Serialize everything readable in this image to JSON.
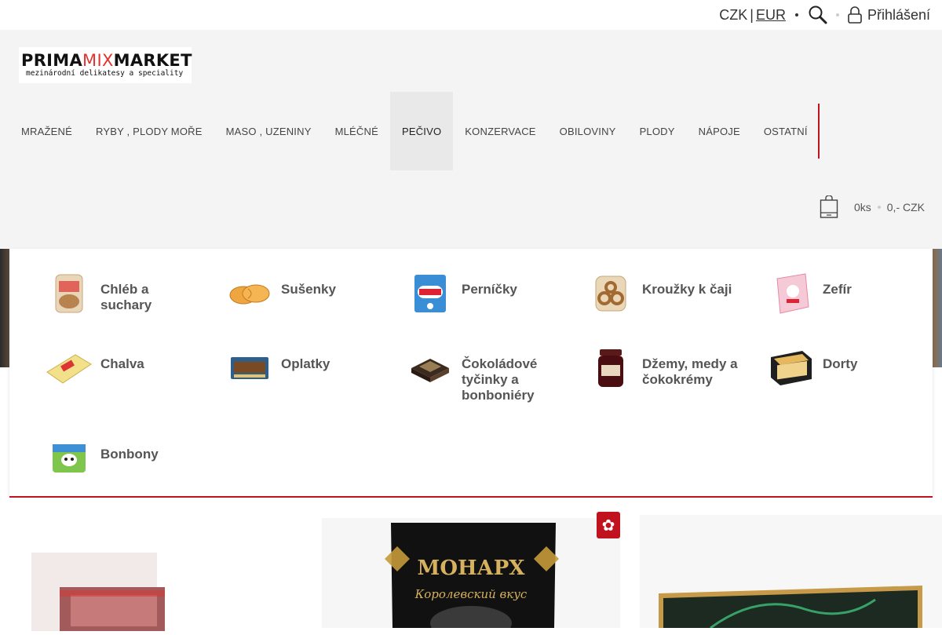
{
  "topbar": {
    "currency_czk": "CZK",
    "currency_sep": "|",
    "currency_eur": "EUR",
    "search_icon": "search-icon",
    "login_label": "Přihlášení"
  },
  "logo": {
    "part1": "PRIMA",
    "part2": "MIX",
    "part3": "MARKET",
    "tagline": "mezinárodní delikatesy a speciality"
  },
  "nav": {
    "items": [
      {
        "label": "MRAŽENÉ"
      },
      {
        "label": "RYBY , PLODY MOŘE"
      },
      {
        "label": "MASO , UZENINY"
      },
      {
        "label": "MLÉČNÉ"
      },
      {
        "label": "PEČIVO",
        "active": true
      },
      {
        "label": "KONZERVACE"
      },
      {
        "label": "OBILOVINY"
      },
      {
        "label": "PLODY"
      },
      {
        "label": "NÁPOJE"
      },
      {
        "label": "OSTATNÍ"
      }
    ]
  },
  "cart": {
    "count": "0ks",
    "total": "0,- CZK"
  },
  "mega_menu": {
    "categories": [
      {
        "label": "Chléb a suchary"
      },
      {
        "label": "Sušenky"
      },
      {
        "label": "Perníčky"
      },
      {
        "label": "Kroužky k čaji"
      },
      {
        "label": "Zefír"
      },
      {
        "label": "Chalva"
      },
      {
        "label": "Oplatky"
      },
      {
        "label": "Čokoládové tyčinky a bonboniéry"
      },
      {
        "label": "Džemy, medy a čokokrémy"
      },
      {
        "label": "Dorty"
      },
      {
        "label": "Bonbony"
      }
    ]
  },
  "products": {
    "product2_brand": "МОНАРХ",
    "product2_tagline": "Королевский вкус"
  },
  "colors": {
    "accent_red": "#c1121f",
    "header_bg": "#f4f4f4"
  }
}
